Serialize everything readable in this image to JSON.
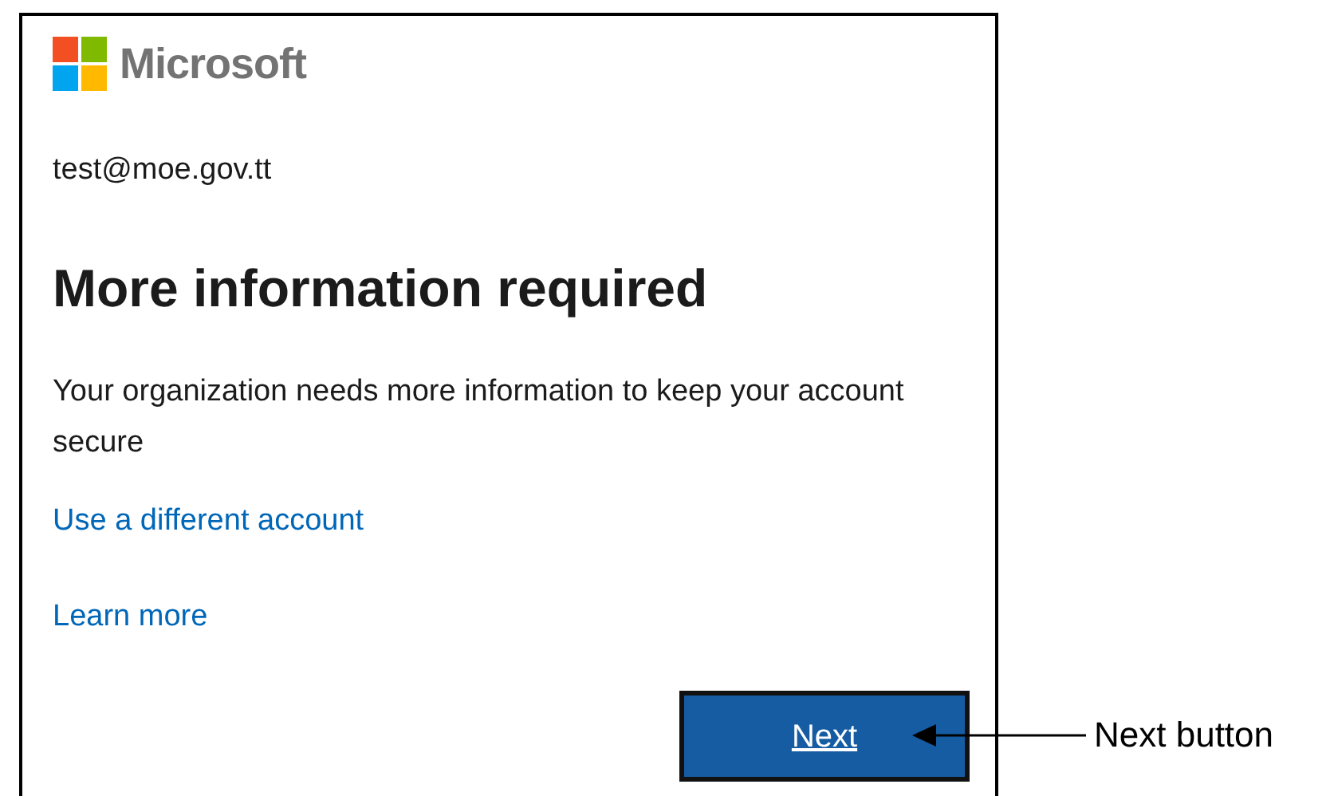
{
  "logo": {
    "text": "Microsoft"
  },
  "email": "test@moe.gov.tt",
  "heading": "More information required",
  "message": "Your organization needs more information to keep your account secure",
  "links": [
    "Use a different account",
    "Learn more"
  ],
  "next_button": {
    "label": "Next"
  },
  "annotation": {
    "label": "Next button"
  }
}
